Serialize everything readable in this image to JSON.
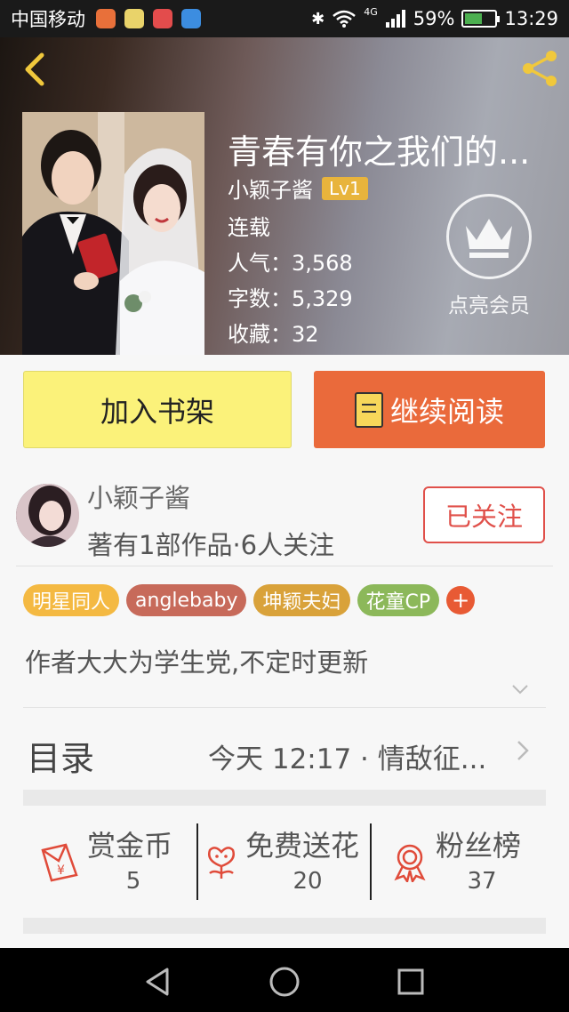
{
  "status_bar": {
    "carrier": "中国移动",
    "network": "4G",
    "battery": "59%",
    "battery_level": 0.59,
    "time": "13:29"
  },
  "book": {
    "title": "青春有你之我们的...",
    "author": "小颖子酱",
    "level": "Lv1",
    "status": "连载",
    "popularity": "人气：3,568",
    "word_count": "字数：5,329",
    "favorites": "收藏：32",
    "vip_label": "点亮会员"
  },
  "actions": {
    "add_to_shelf": "加入书架",
    "continue_reading": "继续阅读"
  },
  "author_section": {
    "name": "小颖子酱",
    "works": "著有1部作品·6人关注",
    "follow": "已关注"
  },
  "tags": [
    {
      "label": "明星同人",
      "color": "#f4b942"
    },
    {
      "label": "anglebaby",
      "color": "#c76a5a"
    },
    {
      "label": "坤颖夫妇",
      "color": "#d9a23a"
    },
    {
      "label": "花童CP",
      "color": "#8cb85a"
    }
  ],
  "tag_add": "+",
  "intro": "作者大大为学生党,不定时更新",
  "catalog": {
    "label": "目录",
    "latest": "今天 12:17 · 情敌征..."
  },
  "stats": [
    {
      "label": "赏金币",
      "value": "5",
      "icon": "red-envelope-icon"
    },
    {
      "label": "免费送花",
      "value": "20",
      "icon": "flower-icon"
    },
    {
      "label": "粉丝榜",
      "value": "37",
      "icon": "medal-icon"
    }
  ],
  "colors": {
    "accent_yellow": "#fbf27a",
    "accent_orange": "#ea6a3b",
    "follow_red": "#e0504a"
  }
}
